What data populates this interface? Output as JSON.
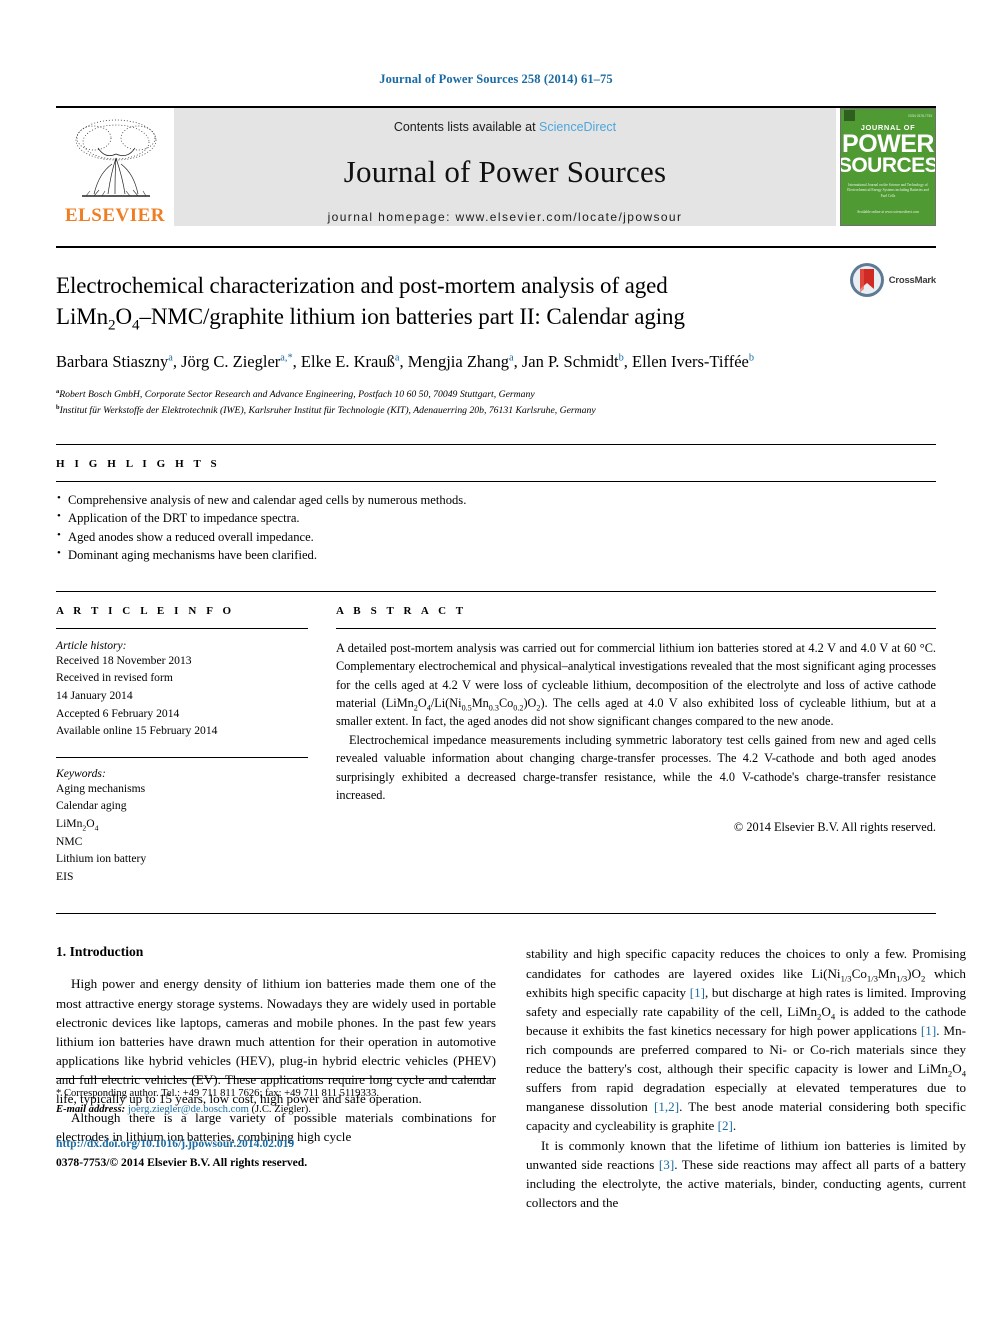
{
  "running_head": "Journal of Power Sources 258 (2014) 61–75",
  "masthead": {
    "contents_prefix": "Contents lists available at",
    "sciencedirect": "ScienceDirect",
    "journal_title": "Journal of Power Sources",
    "homepage": "journal homepage: www.elsevier.com/locate/jpowsour",
    "publisher": "ELSEVIER",
    "cover": {
      "journal_of": "JOURNAL OF",
      "power": "POWER",
      "sources": "SOURCES",
      "subtitle": "International Journal on the Science and Technology of Electrochemical Energy Systems including Batteries and Fuel Cells",
      "bottom": "Available online at www.sciencedirect.com"
    },
    "colors": {
      "link_blue": "#4ea6dd",
      "cover_green": "#4f9a33",
      "elsevier_orange": "#ef7d22"
    }
  },
  "crossmark": {
    "label": "CrossMark"
  },
  "article": {
    "title_line1": "Electrochemical characterization and post-mortem analysis of aged",
    "title_line2_pre": "LiMn",
    "title_line2_post": "–NMC/graphite lithium ion batteries part II: Calendar aging",
    "authors": [
      {
        "name": "Barbara Stiaszny",
        "mark": "a",
        "sep": ", "
      },
      {
        "name": "Jörg C. Ziegler",
        "mark": "a,*",
        "sep": ", "
      },
      {
        "name": "Elke E. Krauß",
        "mark": "a",
        "sep": ", "
      },
      {
        "name": "Mengjia Zhang",
        "mark": "a",
        "sep": ", "
      },
      {
        "name": "Jan P. Schmidt",
        "mark": "b",
        "sep": ", "
      },
      {
        "name": "Ellen Ivers-Tiffée",
        "mark": "b",
        "sep": ""
      }
    ],
    "affiliations": [
      {
        "mark": "a",
        "text": "Robert Bosch GmbH, Corporate Sector Research and Advance Engineering, Postfach 10 60 50, 70049 Stuttgart, Germany"
      },
      {
        "mark": "b",
        "text": "Institut für Werkstoffe der Elektrotechnik (IWE), Karlsruher Institut für Technologie (KIT), Adenauerring 20b, 76131 Karlsruhe, Germany"
      }
    ]
  },
  "highlights": {
    "label": "H I G H L I G H T S",
    "items": [
      "Comprehensive analysis of new and calendar aged cells by numerous methods.",
      "Application of the DRT to impedance spectra.",
      "Aged anodes show a reduced overall impedance.",
      "Dominant aging mechanisms have been clarified."
    ]
  },
  "article_info": {
    "label": "A R T I C L E   I N F O",
    "history_title": "Article history:",
    "history": [
      "Received 18 November 2013",
      "Received in revised form",
      "14 January 2014",
      "Accepted 6 February 2014",
      "Available online 15 February 2014"
    ],
    "keywords_title": "Keywords:",
    "keywords": [
      "Aging mechanisms",
      "Calendar aging",
      "LiMn2O4",
      "NMC",
      "Lithium ion battery",
      "EIS"
    ]
  },
  "abstract": {
    "label": "A B S T R A C T",
    "paragraph1_a": "A detailed post-mortem analysis was carried out for commercial lithium ion batteries stored at 4.2 V and 4.0 V at 60 °C. Complementary electrochemical and physical–analytical investigations revealed that the most significant aging processes for the cells aged at 4.2 V were loss of cycleable lithium, decomposition of the electrolyte and loss of active cathode material (",
    "formula_inline": "LiMn2O4/Li(Ni0.5Mn0.3Co0.2)O2",
    "paragraph1_b": "). The cells aged at 4.0 V also exhibited loss of cycleable lithium, but at a smaller extent. In fact, the aged anodes did not show significant changes compared to the new anode.",
    "paragraph2": "Electrochemical impedance measurements including symmetric laboratory test cells gained from new and aged cells revealed valuable information about changing charge-transfer processes. The 4.2 V-cathode and both aged anodes surprisingly exhibited a decreased charge-transfer resistance, while the 4.0 V-cathode's charge-transfer resistance increased.",
    "copyright": "© 2014 Elsevier B.V. All rights reserved."
  },
  "introduction": {
    "heading": "1. Introduction",
    "left_p1": "High power and energy density of lithium ion batteries made them one of the most attractive energy storage systems. Nowadays they are widely used in portable electronic devices like laptops, cameras and mobile phones. In the past few years lithium ion batteries have drawn much attention for their operation in automotive applications like hybrid vehicles (HEV), plug-in hybrid electric vehicles (PHEV) and full electric vehicles (EV). These applications require long cycle and calendar life, typically up to 15 years, low cost, high power and safe operation.",
    "left_p2": "Although there is a large variety of possible materials combinations for electrodes in lithium ion batteries, combining high cycle",
    "right_p1_a": "stability and high specific capacity reduces the choices to only a few. Promising candidates for cathodes are layered oxides like ",
    "right_formula1": "Li(Ni1/3Co1/3Mn1/3)O2",
    "right_p1_b": " which exhibits high specific capacity ",
    "cite1": "[1]",
    "right_p1_c": ", but discharge at high rates is limited. Improving safety and especially rate capability of the cell, ",
    "right_formula2": "LiMn2O4",
    "right_p1_d": " is added to the cathode because it exhibits the fast kinetics necessary for high power applications ",
    "cite2": "[1]",
    "right_p1_e": ". Mn-rich compounds are preferred compared to Ni- or Co-rich materials since they reduce the battery's cost, although their specific capacity is lower and ",
    "right_formula3": "LiMn2O4",
    "right_p1_f": " suffers from rapid degradation especially at elevated temperatures due to manganese dissolution ",
    "cite3": "[1,2]",
    "right_p1_g": ". The best anode material considering both specific capacity and cycleability is graphite ",
    "cite4": "[2]",
    "right_p1_h": ".",
    "right_p2_a": "It is commonly known that the lifetime of lithium ion batteries is limited by unwanted side reactions ",
    "cite5": "[3]",
    "right_p2_b": ". These side reactions may affect all parts of a battery including the electrolyte, the active materials, binder, conducting agents, current collectors and the"
  },
  "footer": {
    "corresponding": "* Corresponding author. Tel.: +49 711 811 7626; fax: +49 711 811 5119333.",
    "email_label": "E-mail address:",
    "email": "joerg.ziegler@de.bosch.com",
    "email_suffix": "(J.C. Ziegler).",
    "doi": "http://dx.doi.org/10.1016/j.jpowsour.2014.02.019",
    "issn": "0378-7753/© 2014 Elsevier B.V. All rights reserved."
  }
}
